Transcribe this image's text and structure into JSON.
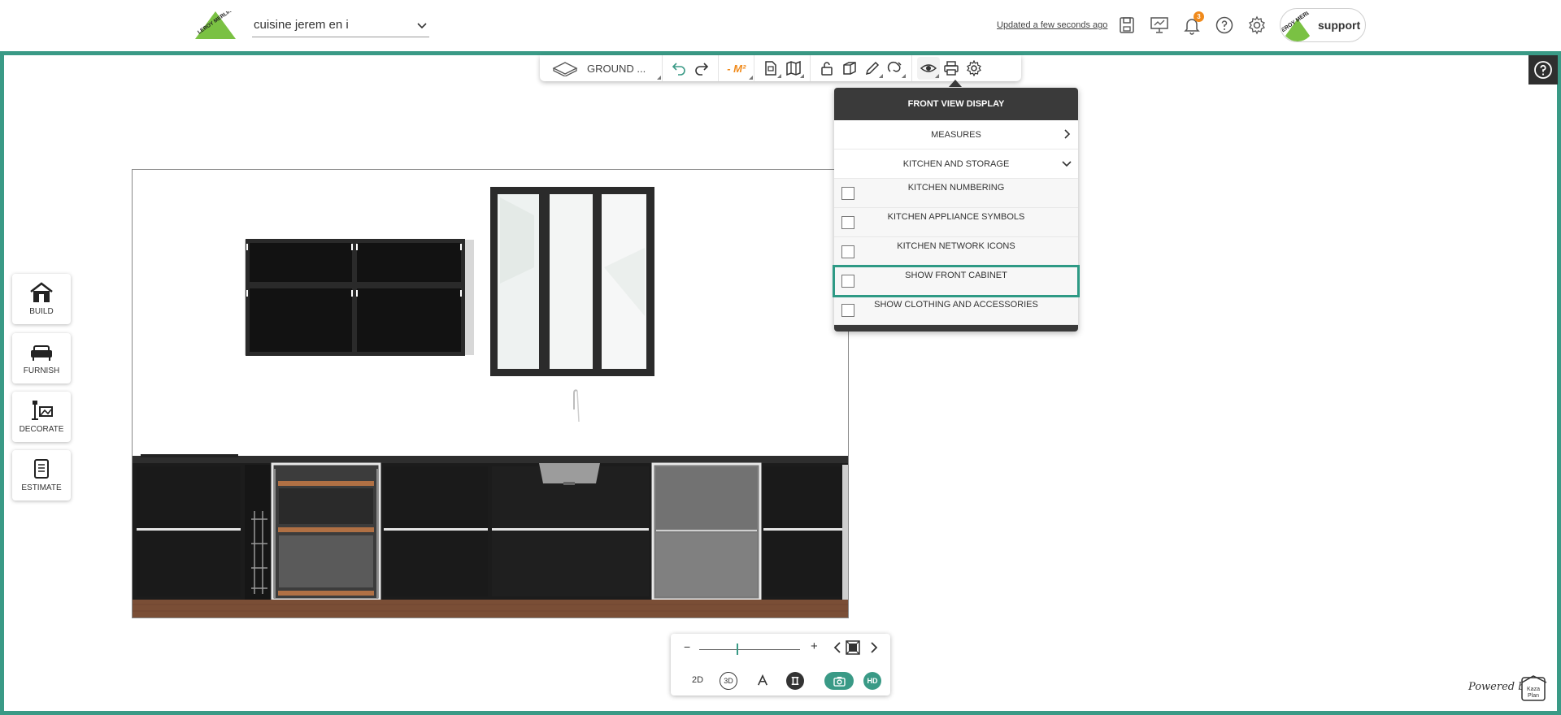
{
  "header": {
    "project_name": "cuisine jerem en i",
    "updated_text": "Updated a few seconds ago",
    "notifications_count": "3",
    "support_label": "support",
    "logo_text": "LEROY MERLIN",
    "avatar_text": "LEROY MERLIN"
  },
  "toolbar": {
    "floor_label": "GROUND ...",
    "area_label": "- M²"
  },
  "side_menu": [
    {
      "label": "BUILD",
      "icon": "house-icon"
    },
    {
      "label": "FURNISH",
      "icon": "sofa-icon"
    },
    {
      "label": "DECORATE",
      "icon": "lamp-picture-icon"
    },
    {
      "label": "ESTIMATE",
      "icon": "clipboard-icon"
    }
  ],
  "panel": {
    "title": "FRONT VIEW DISPLAY",
    "sections": [
      {
        "label": "MEASURES",
        "state": "collapsed"
      },
      {
        "label": "KITCHEN AND STORAGE",
        "state": "expanded"
      }
    ],
    "options": [
      {
        "label": "KITCHEN NUMBERING",
        "checked": false
      },
      {
        "label": "KITCHEN APPLIANCE SYMBOLS",
        "checked": false
      },
      {
        "label": "KITCHEN NETWORK ICONS",
        "checked": false
      },
      {
        "label": "SHOW FRONT CABINET",
        "checked": false,
        "highlighted": true
      },
      {
        "label": "SHOW CLOTHING AND ACCESSORIES",
        "checked": false
      }
    ]
  },
  "bottom": {
    "zoom_minus": "−",
    "zoom_plus": "+",
    "zoom_level": 0.38,
    "view_2d": "2D",
    "view_3d": "3D",
    "hd": "HD"
  },
  "footer": {
    "powered_by": "Powered by",
    "brand": "Kazaplan"
  },
  "colors": {
    "accent": "#3a9a86",
    "badge": "#f08a1b",
    "brand_green": "#7ac143"
  }
}
